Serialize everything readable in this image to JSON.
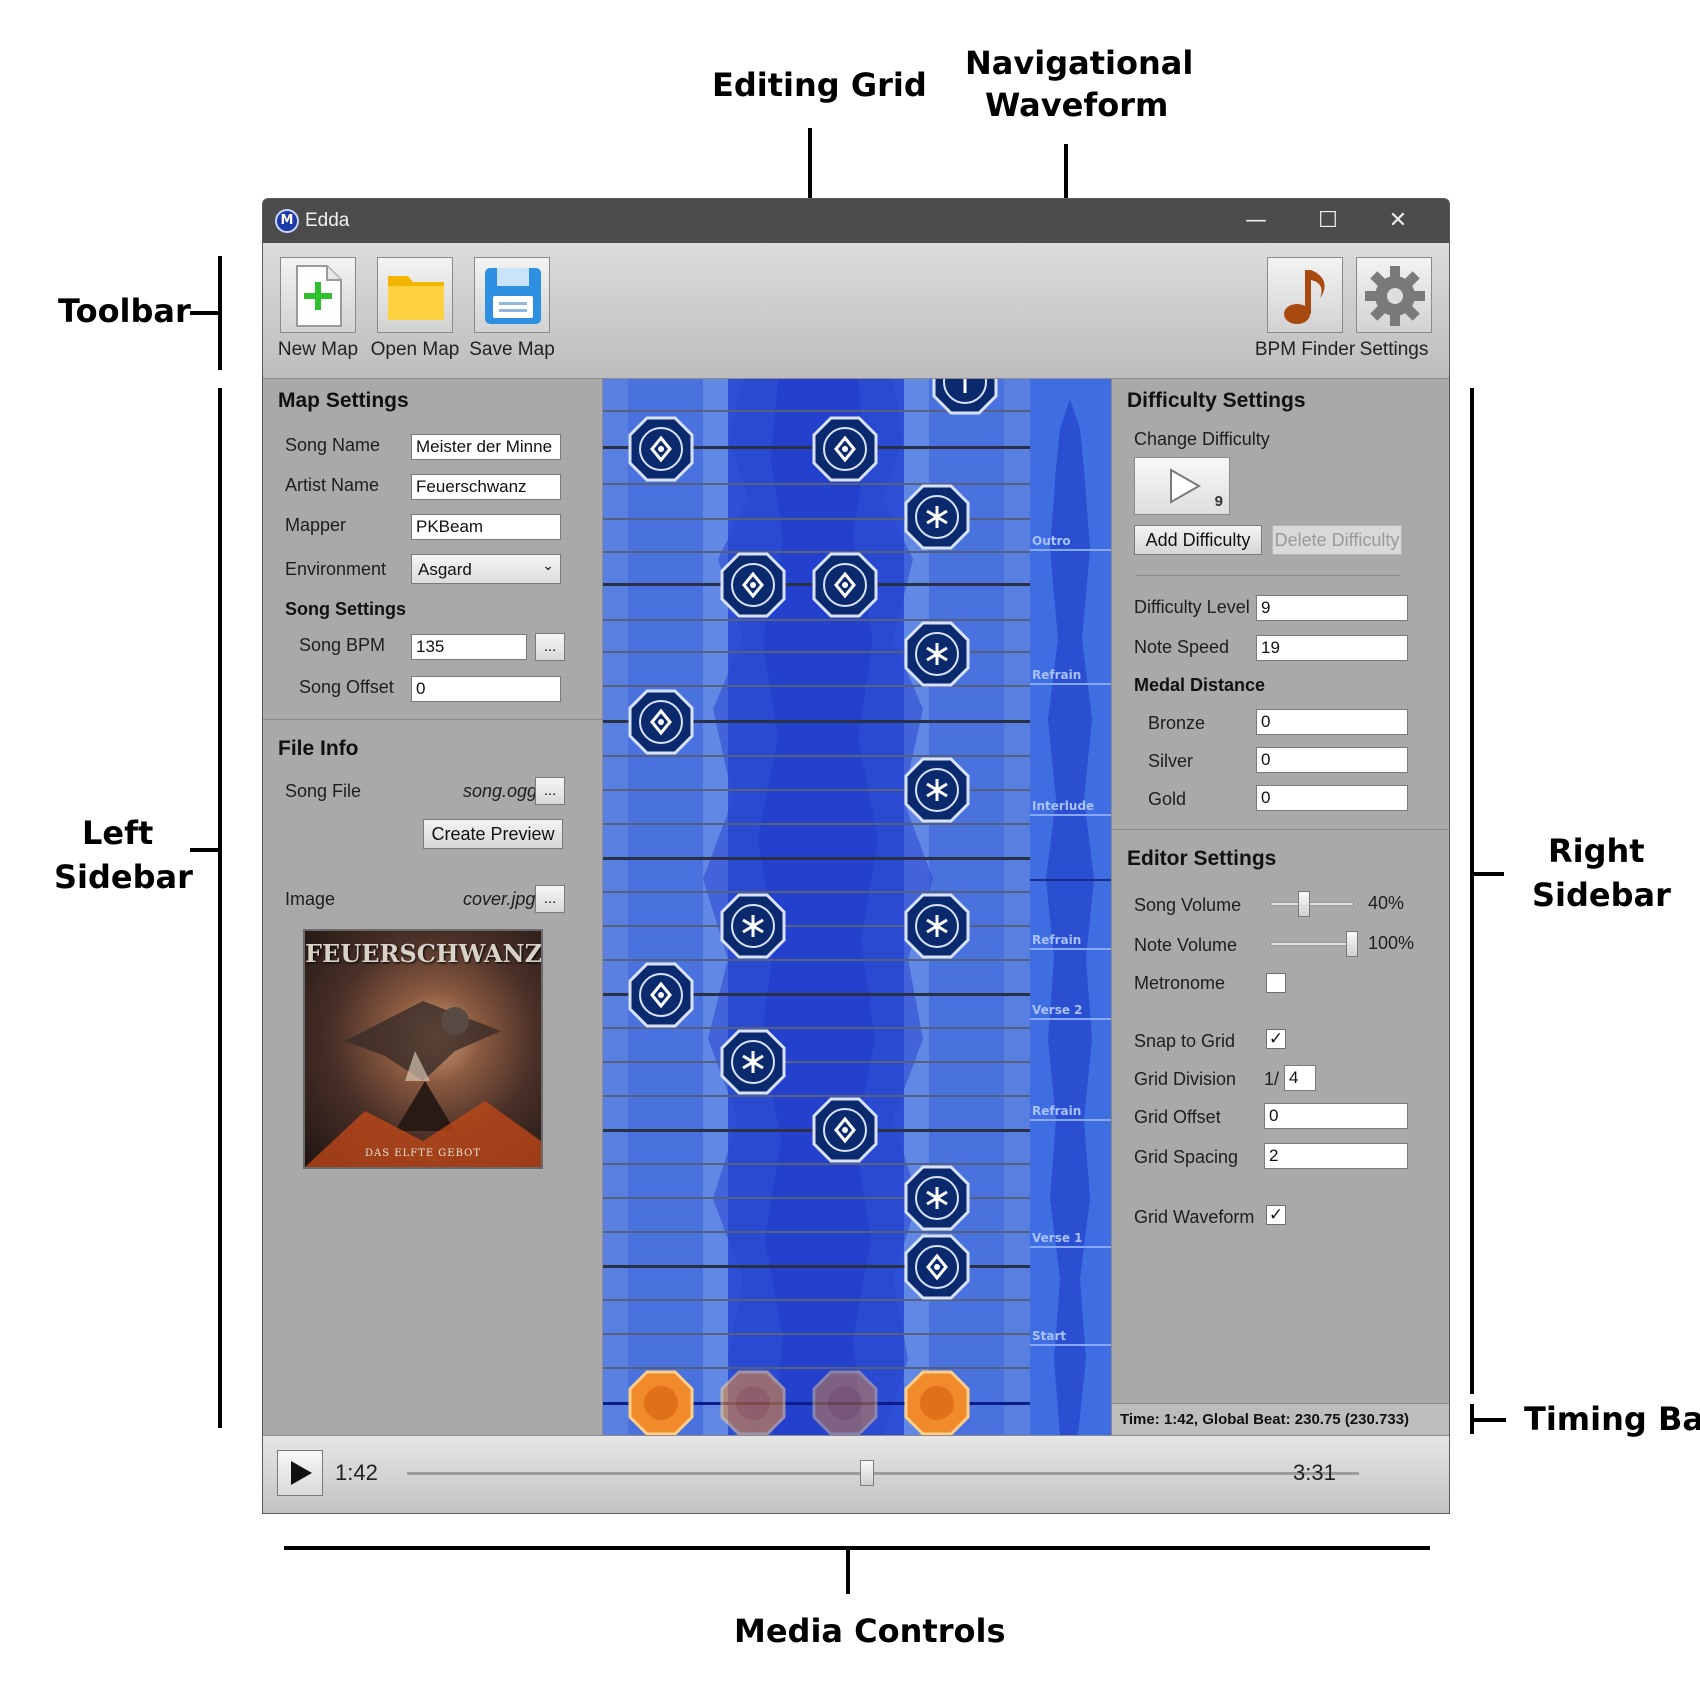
{
  "annotations": {
    "editing_grid": "Editing Grid",
    "nav_waveform_1": "Navigational",
    "nav_waveform_2": "Waveform",
    "toolbar": "Toolbar",
    "left_sidebar_1": "Left",
    "left_sidebar_2": "Sidebar",
    "right_sidebar_1": "Right",
    "right_sidebar_2": "Sidebar",
    "timing_bar": "Timing Bar",
    "media_controls": "Media Controls"
  },
  "window": {
    "title": "Edda",
    "controls": {
      "minimize": "—",
      "maximize": "☐",
      "close": "✕"
    }
  },
  "toolbar": {
    "new_map": "New Map",
    "open_map": "Open Map",
    "save_map": "Save Map",
    "bpm_finder": "BPM Finder",
    "settings": "Settings"
  },
  "map_settings": {
    "title": "Map Settings",
    "song_name_label": "Song Name",
    "song_name": "Meister der Minne",
    "artist_name_label": "Artist Name",
    "artist_name": "Feuerschwanz",
    "mapper_label": "Mapper",
    "mapper": "PKBeam",
    "environment_label": "Environment",
    "environment": "Asgard",
    "song_settings_title": "Song Settings",
    "song_bpm_label": "Song BPM",
    "song_bpm": "135",
    "song_offset_label": "Song Offset",
    "song_offset": "0",
    "browse": "..."
  },
  "file_info": {
    "title": "File Info",
    "song_file_label": "Song File",
    "song_file": "song.ogg",
    "create_preview": "Create Preview",
    "image_label": "Image",
    "image_file": "cover.jpg",
    "cover_band": "FEUERSCHWANZ",
    "cover_subtitle": "DAS ELFTE GEBOT"
  },
  "difficulty_settings": {
    "title": "Difficulty Settings",
    "change_difficulty": "Change Difficulty",
    "difficulty_badge": "9",
    "add_difficulty": "Add Difficulty",
    "delete_difficulty": "Delete Difficulty",
    "difficulty_level_label": "Difficulty Level",
    "difficulty_level": "9",
    "note_speed_label": "Note Speed",
    "note_speed": "19",
    "medal_distance_title": "Medal Distance",
    "bronze_label": "Bronze",
    "bronze": "0",
    "silver_label": "Silver",
    "silver": "0",
    "gold_label": "Gold",
    "gold": "0"
  },
  "editor_settings": {
    "title": "Editor Settings",
    "song_volume_label": "Song Volume",
    "song_volume": "40%",
    "song_volume_value": 0.4,
    "note_volume_label": "Note Volume",
    "note_volume": "100%",
    "note_volume_value": 1.0,
    "metronome_label": "Metronome",
    "metronome": false,
    "snap_to_grid_label": "Snap to Grid",
    "snap_to_grid": true,
    "grid_division_label": "Grid Division",
    "grid_division_prefix": "1/",
    "grid_division": "4",
    "grid_offset_label": "Grid Offset",
    "grid_offset": "0",
    "grid_spacing_label": "Grid Spacing",
    "grid_spacing": "2",
    "grid_waveform_label": "Grid Waveform",
    "grid_waveform": true
  },
  "navigation_sections": [
    "Outro",
    "Refrain",
    "Interlude",
    "Refrain",
    "Verse 2",
    "Refrain",
    "Verse 1",
    "Start"
  ],
  "timing_bar": {
    "text": "Time: 1:42, Global Beat: 230.75 (230.733)"
  },
  "media": {
    "current_time": "1:42",
    "total_time": "3:31",
    "progress": 0.483,
    "play_icon": "play-icon"
  },
  "colors": {
    "grid_blue": "#3c63d8",
    "note_navy": "#0b2a6e",
    "note_orange": "#f08a2a",
    "nav_section_text": "#a9c2ff"
  }
}
